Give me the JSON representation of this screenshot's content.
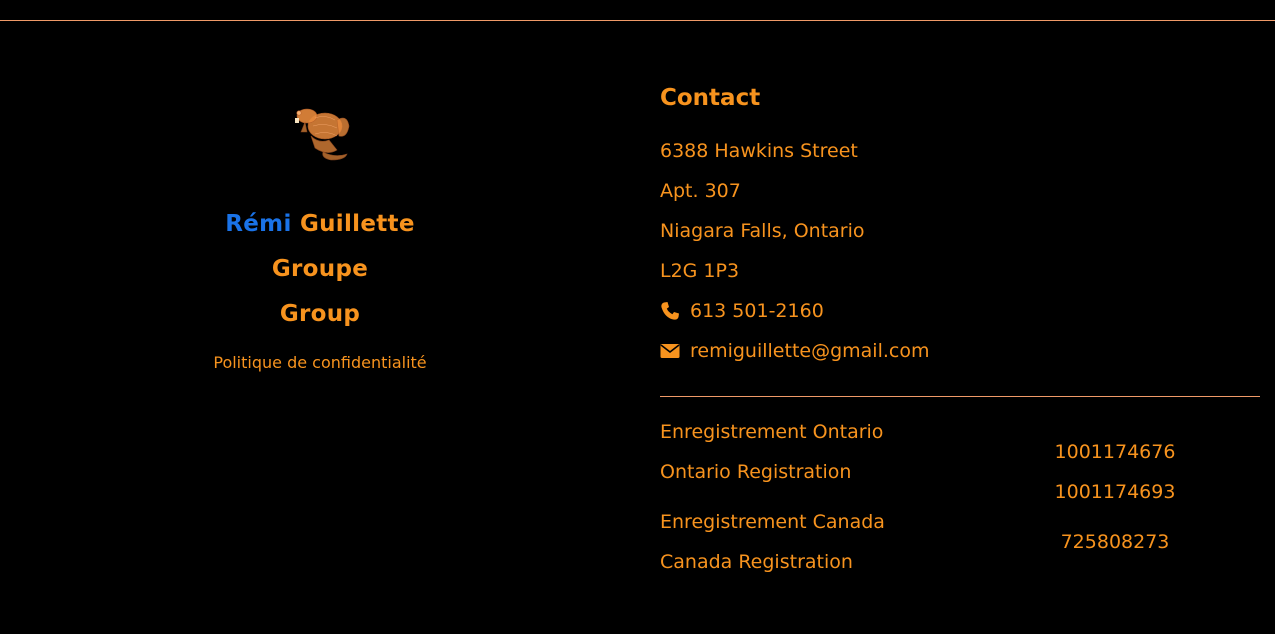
{
  "colors": {
    "background": "#000000",
    "accent": "#f7931e",
    "brand_blue": "#1a73e8",
    "rule": "#f09a68"
  },
  "brand": {
    "logo_icon": "beaver-icon",
    "first_name": "Rémi",
    "last_name": "Guillette",
    "line2": "Groupe",
    "line3": "Group",
    "privacy_link": "Politique de confidentialité"
  },
  "contact": {
    "heading": "Contact",
    "address": [
      "6388 Hawkins Street",
      "Apt. 307",
      "Niagara Falls, Ontario",
      "L2G 1P3"
    ],
    "phone_icon": "phone-icon",
    "phone": "613 501-2160",
    "email_icon": "envelope-icon",
    "email": "remiguillette@gmail.com"
  },
  "registration": {
    "ontario_fr": "Enregistrement Ontario",
    "ontario_en": "Ontario Registration",
    "ontario_numbers": [
      "1001174676",
      "1001174693"
    ],
    "canada_fr": "Enregistrement Canada",
    "canada_en": "Canada Registration",
    "canada_number": "725808273"
  }
}
